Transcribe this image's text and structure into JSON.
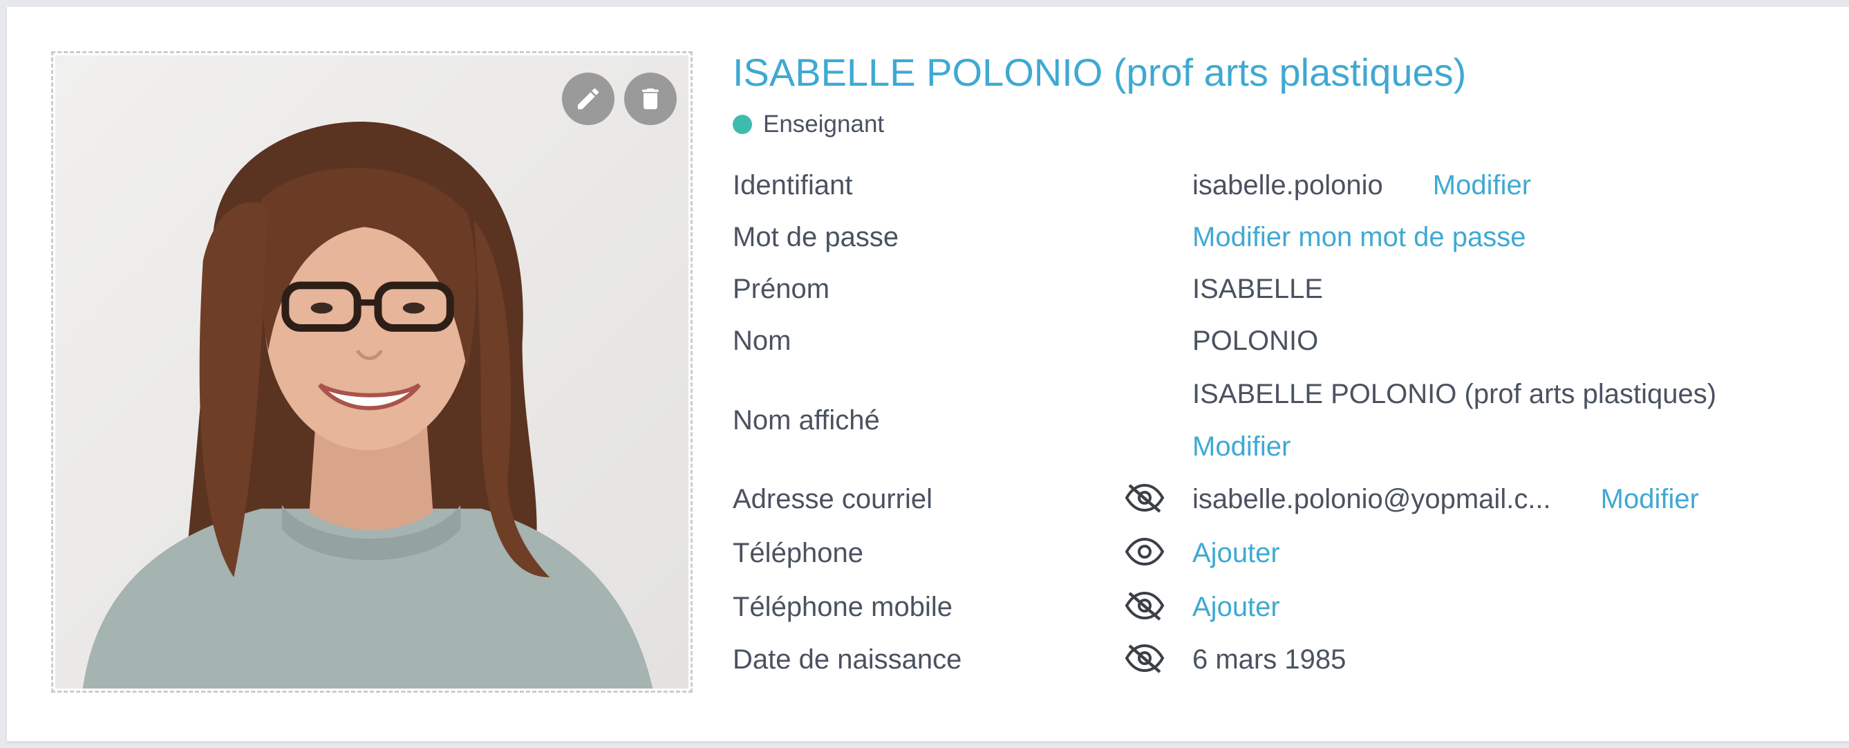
{
  "profile": {
    "title": "ISABELLE POLONIO (prof arts plastiques)",
    "role": "Enseignant",
    "role_color": "#3dbcae",
    "accent_color": "#3fa9d2",
    "photo": {
      "edit_icon": "pencil-icon",
      "delete_icon": "trash-icon"
    }
  },
  "fields": {
    "identifiant": {
      "label": "Identifiant",
      "value": "isabelle.polonio",
      "action": "Modifier"
    },
    "mot_de_passe": {
      "label": "Mot de passe",
      "action": "Modifier mon mot de passe"
    },
    "prenom": {
      "label": "Prénom",
      "value": "ISABELLE"
    },
    "nom": {
      "label": "Nom",
      "value": "POLONIO"
    },
    "nom_affiche": {
      "label": "Nom affiché",
      "value": "ISABELLE POLONIO (prof arts plastiques)",
      "action": "Modifier"
    },
    "courriel": {
      "label": "Adresse courriel",
      "visibility": "eye-off-icon",
      "value": "isabelle.polonio@yopmail.c...",
      "action": "Modifier"
    },
    "telephone": {
      "label": "Téléphone",
      "visibility": "eye-icon",
      "action": "Ajouter"
    },
    "telephone_mobile": {
      "label": "Téléphone mobile",
      "visibility": "eye-off-icon",
      "action": "Ajouter"
    },
    "date_naissance": {
      "label": "Date de naissance",
      "visibility": "eye-off-icon",
      "value": "6 mars 1985"
    }
  }
}
